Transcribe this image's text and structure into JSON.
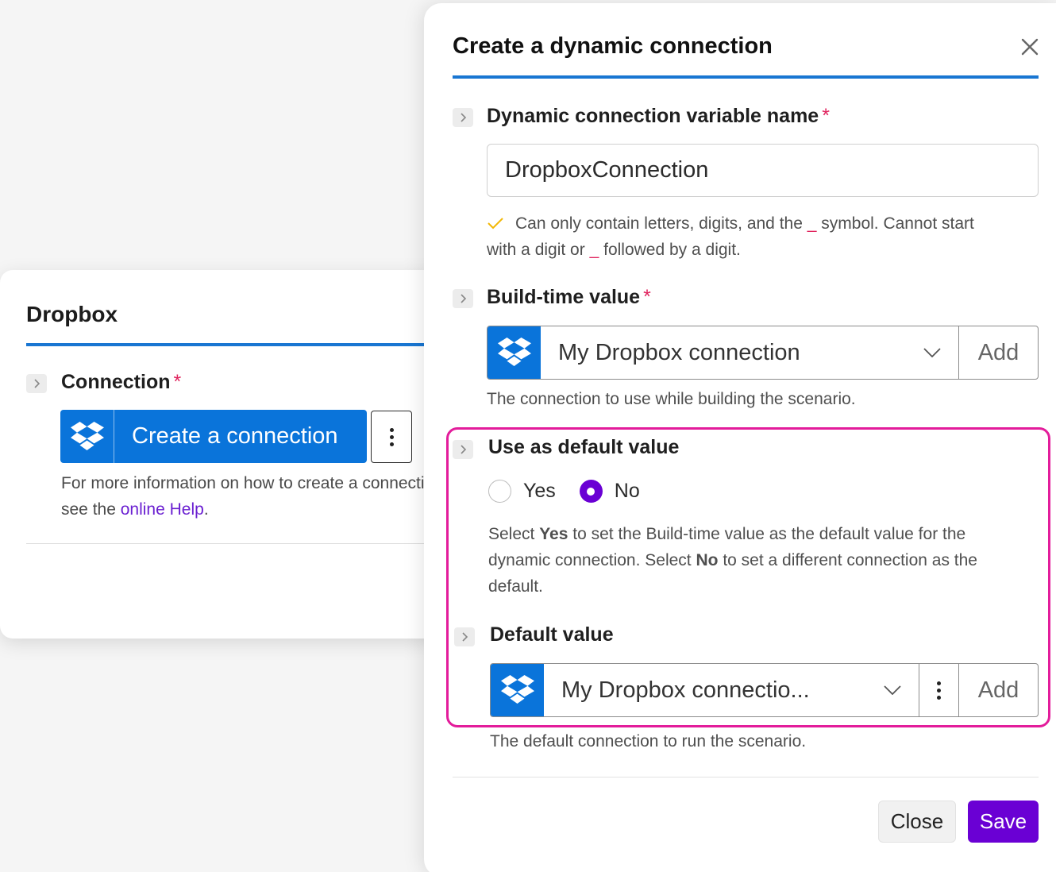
{
  "left_panel": {
    "title": "Dropbox",
    "connection_label": "Connection",
    "required_marker": "*",
    "create_button_label": "Create a connection",
    "help_text_1": "For more information on how to create a connection,",
    "help_text_2": "see the ",
    "help_link": "online Help",
    "help_text_3": "."
  },
  "dialog": {
    "title": "Create a dynamic connection",
    "variable_name": {
      "label": "Dynamic connection variable name",
      "required_marker": "*",
      "value": "DropboxConnection",
      "hint_1": "Can only contain letters, digits, and the",
      "hint_code_1": "_",
      "hint_2": "symbol. Cannot start",
      "hint_3": "with a digit or",
      "hint_code_2": "_",
      "hint_4": "followed by a digit."
    },
    "build_time": {
      "label": "Build-time value",
      "required_marker": "*",
      "selected": "My Dropbox connection",
      "add_label": "Add",
      "hint": "The connection to use while building the scenario."
    },
    "use_default": {
      "label": "Use as default value",
      "options": [
        "Yes",
        "No"
      ],
      "selected": "No",
      "desc_1": "Select ",
      "desc_bold_1": "Yes",
      "desc_2": " to set the Build-time value as the default value for the",
      "desc_3": "dynamic connection. Select ",
      "desc_bold_2": "No",
      "desc_4": " to set a different connection as the",
      "desc_5": "default."
    },
    "default_value": {
      "label": "Default value",
      "selected": "My Dropbox connectio...",
      "add_label": "Add",
      "hint": "The default connection to run the scenario."
    },
    "close_label": "Close",
    "save_label": "Save"
  },
  "colors": {
    "accent_blue": "#1976d2",
    "dropbox_blue": "#0a74da",
    "primary_purple": "#6a00d4",
    "highlight_pink": "#e31c9b",
    "required_red": "#e0245e"
  },
  "icons": {
    "chevron": "chevron-right-icon",
    "close": "close-icon",
    "dropbox": "dropbox-logo-icon",
    "caret": "chevron-down-icon",
    "more": "more-vertical-icon",
    "check": "check-icon"
  }
}
